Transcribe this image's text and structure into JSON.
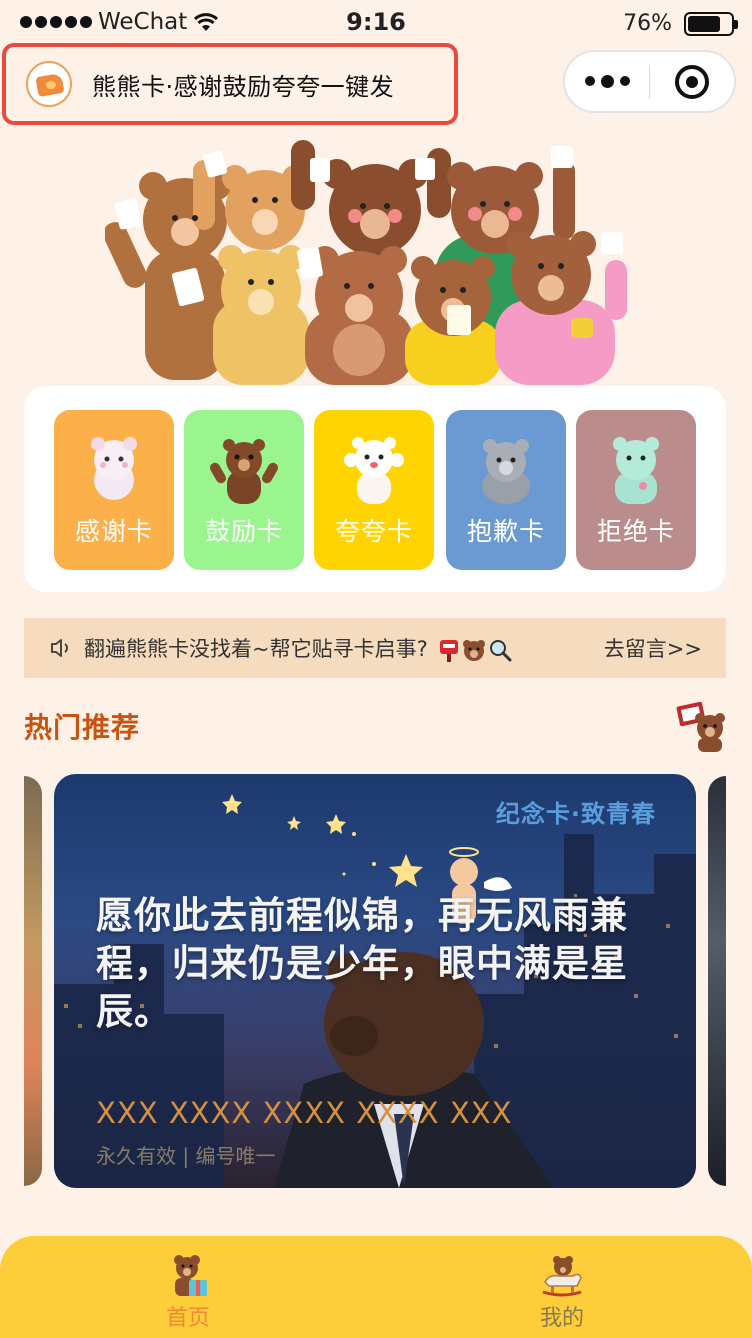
{
  "status_bar": {
    "carrier": "WeChat",
    "time": "9:16",
    "battery_text": "76%",
    "battery_level": 0.76
  },
  "header": {
    "title": "熊熊卡·感谢鼓励夸夸一键发",
    "logo_icon": "bear-card-logo-icon",
    "more_icon": "more-dots-icon",
    "close_icon": "target-close-icon"
  },
  "categories": [
    {
      "label": "感谢卡",
      "color": "#fbb04a",
      "icon": "white-bear-icon"
    },
    {
      "label": "鼓励卡",
      "color": "#9af58f",
      "icon": "brown-bear-icon"
    },
    {
      "label": "夸夸卡",
      "color": "#ffd400",
      "icon": "polar-bear-icon"
    },
    {
      "label": "抱歉卡",
      "color": "#6b9ad3",
      "icon": "gray-bear-icon"
    },
    {
      "label": "拒绝卡",
      "color": "#bb8c8c",
      "icon": "mint-bear-icon"
    }
  ],
  "notice": {
    "icon": "speaker-icon",
    "text": "翻遍熊熊卡没找着~帮它贴寻卡启事?",
    "link": "去留言>>"
  },
  "section": {
    "title": "热门推荐",
    "icon": "bear-with-sign-icon"
  },
  "featured_card": {
    "tag": "纪念卡·致青春",
    "quote": "愿你此去前程似锦，再无风雨兼程，归来仍是少年，眼中满是星辰。",
    "name": "XXX XXXX XXXX XXXX XXX",
    "sub": "永久有效 | 编号唯一"
  },
  "tab_bar": {
    "items": [
      {
        "label": "首页",
        "icon": "bear-gift-icon",
        "active": true
      },
      {
        "label": "我的",
        "icon": "bear-rocking-horse-icon",
        "active": false
      }
    ]
  }
}
